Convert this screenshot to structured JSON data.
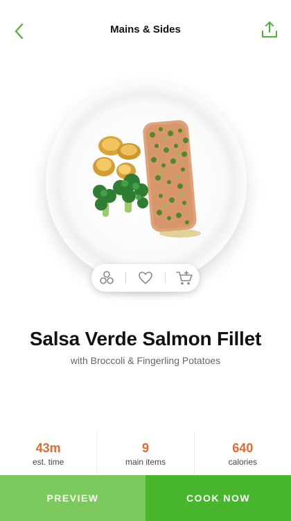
{
  "header": {
    "title": "Mains & Sides",
    "back_icon": "chevron-left-icon",
    "share_icon": "share-upload-icon",
    "accent_color": "#48b62c"
  },
  "recipe": {
    "image": "salsa-verde-salmon-plate-photo",
    "title": "Salsa Verde Salmon Fillet",
    "subtitle": "with Broccoli & Fingerling Potatoes",
    "actions": [
      {
        "icon": "ingredients-icon"
      },
      {
        "icon": "heart-icon"
      },
      {
        "icon": "add-to-cart-icon"
      }
    ]
  },
  "stats": [
    {
      "value": "43m",
      "label": "est. time"
    },
    {
      "value": "9",
      "label": "main items"
    },
    {
      "value": "640",
      "label": "calories"
    }
  ],
  "stat_color": "#e36a2c",
  "buttons": {
    "preview": "PREVIEW",
    "cook_now": "COOK NOW"
  }
}
